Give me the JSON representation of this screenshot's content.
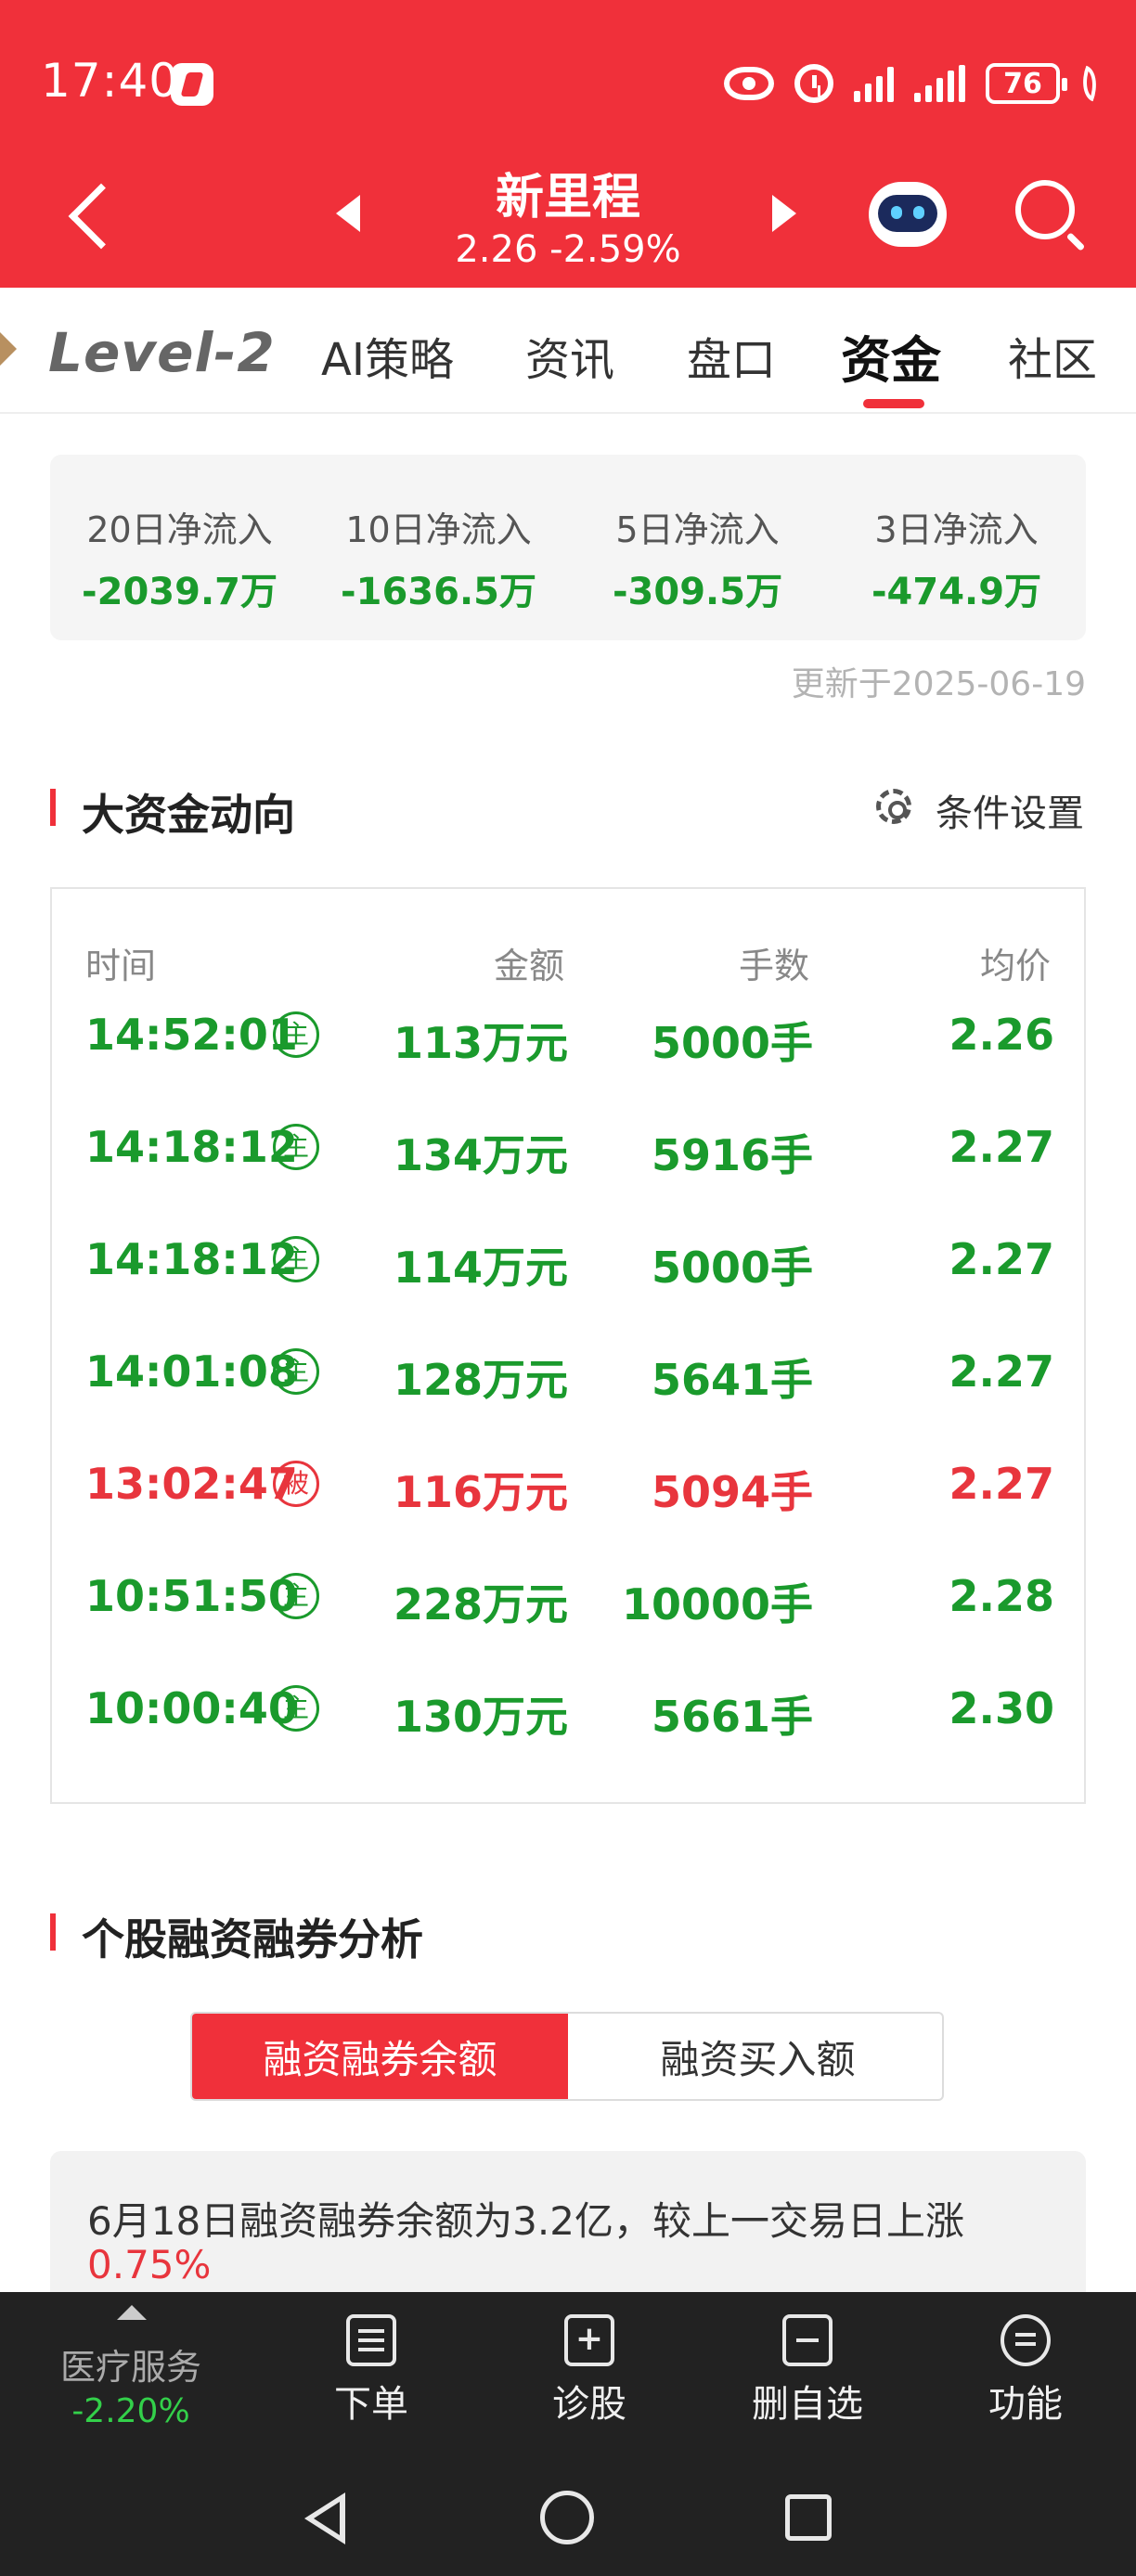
{
  "status_bar": {
    "time": "17:40",
    "battery": "76"
  },
  "header": {
    "stock_name": "新里程",
    "stock_price": "2.26 -2.59%"
  },
  "tabs": {
    "level2": "Level-2",
    "items": [
      "AI策略",
      "资讯",
      "盘口",
      "资金",
      "社区"
    ],
    "active": "资金"
  },
  "net_inflow": [
    {
      "label": "20日净流入",
      "value": "-2039.7万"
    },
    {
      "label": "10日净流入",
      "value": "-1636.5万"
    },
    {
      "label": "5日净流入",
      "value": "-309.5万"
    },
    {
      "label": "3日净流入",
      "value": "-474.9万"
    }
  ],
  "update_time": "更新于2025-06-19",
  "big_flow": {
    "title": "大资金动向",
    "settings_label": "条件设置",
    "headers": [
      "时间",
      "金额",
      "手数",
      "均价"
    ],
    "rows": [
      {
        "time": "14:52:01",
        "type": "主",
        "amount": "113万元",
        "volume": "5000手",
        "avg": "2.26",
        "color": "#1a9a2c"
      },
      {
        "time": "14:18:12",
        "type": "主",
        "amount": "134万元",
        "volume": "5916手",
        "avg": "2.27",
        "color": "#1a9a2c"
      },
      {
        "time": "14:18:12",
        "type": "主",
        "amount": "114万元",
        "volume": "5000手",
        "avg": "2.27",
        "color": "#1a9a2c"
      },
      {
        "time": "14:01:08",
        "type": "主",
        "amount": "128万元",
        "volume": "5641手",
        "avg": "2.27",
        "color": "#1a9a2c"
      },
      {
        "time": "13:02:47",
        "type": "被",
        "amount": "116万元",
        "volume": "5094手",
        "avg": "2.27",
        "color": "#e8353d"
      },
      {
        "time": "10:51:50",
        "type": "主",
        "amount": "228万元",
        "volume": "10000手",
        "avg": "2.28",
        "color": "#1a9a2c"
      },
      {
        "time": "10:00:40",
        "type": "主",
        "amount": "130万元",
        "volume": "5661手",
        "avg": "2.30",
        "color": "#1a9a2c"
      }
    ]
  },
  "margin": {
    "title": "个股融资融券分析",
    "seg_active": "融资融券余额",
    "seg_inactive": "融资买入额",
    "summary": "6月18日融资融券余额为3.2亿，较上一交易日上涨",
    "change_pct": "0.75%"
  },
  "bottom_bar": {
    "sector_name": "医疗服务",
    "sector_change": "-2.20%",
    "order_label": "下单",
    "diagnose_label": "诊股",
    "remove_label": "删自选",
    "function_label": "功能"
  },
  "colors": {
    "brand_red": "#f0303a",
    "up_red": "#e8353d",
    "down_green": "#1a9a2c"
  }
}
